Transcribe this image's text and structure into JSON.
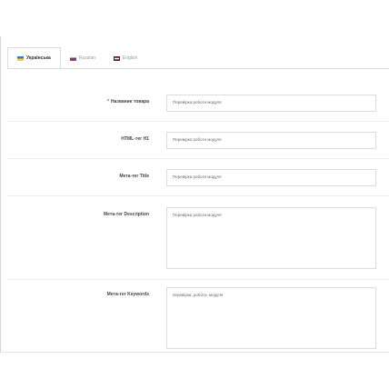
{
  "tabs": [
    {
      "label": "Українська",
      "flag": "ua-flag-icon",
      "active": true
    },
    {
      "label": "Russian",
      "flag": "ru-flag-icon",
      "active": false
    },
    {
      "label": "English",
      "flag": "en-flag-icon",
      "active": false
    }
  ],
  "fields": {
    "product_name": {
      "label": "Название товара",
      "required": "*",
      "value": "Перевірка роботи модуля"
    },
    "h1_tag": {
      "label": "HTML-тег H1",
      "value": "Перевірка роботи модуля"
    },
    "meta_title": {
      "label": "Мета-тег Title",
      "value": "Перевірка роботи модуля"
    },
    "meta_description": {
      "label": "Мета-тег Description",
      "value": "Перевірка роботи модуля"
    },
    "meta_keywords": {
      "label": "Мета-тег Keywords",
      "value": "перевірка, роботи, модуля"
    }
  }
}
